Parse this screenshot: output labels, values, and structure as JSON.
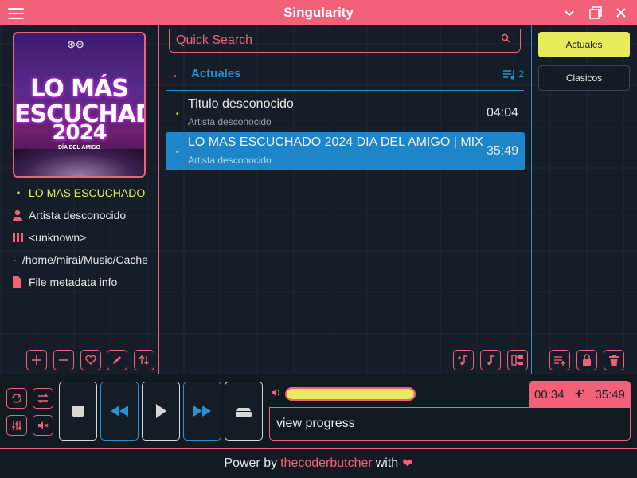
{
  "window": {
    "title": "Singularity",
    "minimize_glyph": "⌄",
    "maximize_glyph": "⧉",
    "close_glyph": "✕"
  },
  "now_playing": {
    "cover_art": {
      "line1": "LO MÁS",
      "line2": "ESCUCHADO",
      "line3": "2024",
      "subtitle": "DÍA DEL AMIGO"
    },
    "title": "LO MAS ESCUCHADO 2024 DIA DEL AMIGO | MIX",
    "artist": "Artista desconocido",
    "album": "<unknown>",
    "path": "/home/mirai/Music/Cache/",
    "metadata_link": "File metadata info"
  },
  "search": {
    "placeholder": "Quick Search"
  },
  "playlist": {
    "name": "Actuales",
    "count": "2",
    "tracks": [
      {
        "title": "Titulo desconocido",
        "artist": "Artista desconocido",
        "duration": "04:04"
      },
      {
        "title": "LO MAS ESCUCHADO 2024 DIA DEL AMIGO | MIX",
        "artist": "Artista desconocido",
        "duration": "35:49"
      }
    ]
  },
  "playlists_panel": {
    "items": [
      "Actuales",
      "Clasicos"
    ]
  },
  "player": {
    "current_time": "00:34",
    "total_time": "35:49",
    "progress_label": "view progress",
    "volume_fraction": 1.0
  },
  "footer": {
    "prefix": "Power by",
    "author": "thecoderbutcher",
    "suffix": "with",
    "heart": "❤"
  },
  "colors": {
    "accent": "#f2607a",
    "highlight": "#e8ec5c",
    "blue": "#2b8ecf",
    "background": "#151e28"
  }
}
